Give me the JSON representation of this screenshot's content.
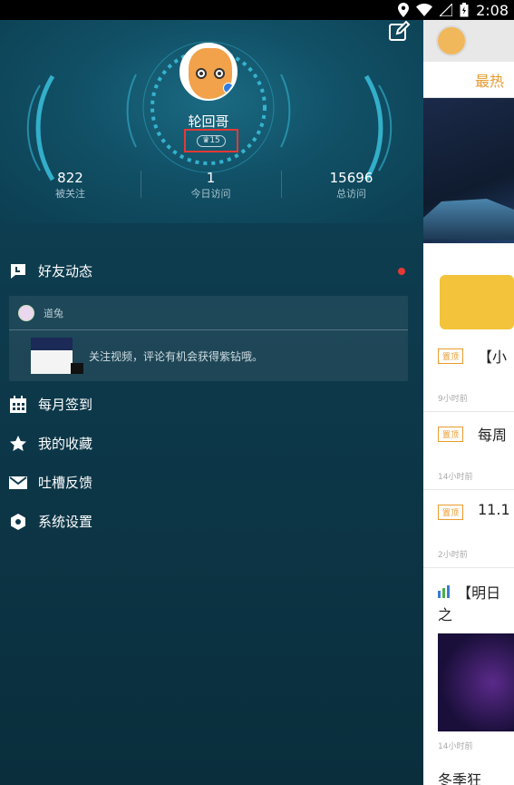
{
  "status_bar": {
    "time": "2:08"
  },
  "drawer": {
    "username": "轮回哥",
    "level": "15",
    "stats": [
      {
        "value": "822",
        "label": "被关注"
      },
      {
        "value": "1",
        "label": "今日访问"
      },
      {
        "value": "15696",
        "label": "总访问"
      }
    ],
    "menu": {
      "friend_feed": "好友动态",
      "monthly_checkin": "每月签到",
      "favorites": "我的收藏",
      "feedback": "吐槽反馈",
      "settings": "系统设置"
    },
    "friend_card": {
      "user": "道兔",
      "text": "关注视频，评论有机会获得紫钻哦。"
    }
  },
  "main": {
    "tab_hot": "最热",
    "feed": [
      {
        "tag": "置顶",
        "title": "【小",
        "time": "9小时前"
      },
      {
        "tag": "置顶",
        "title": "每周",
        "time": "14小时前"
      },
      {
        "tag": "置顶",
        "title": "11.1",
        "time": "2小时前"
      }
    ],
    "section_title": "【明日之",
    "section_time": "14小时前",
    "bottom_text": "冬季狂欢，"
  },
  "colors": {
    "accent": "#e89b2e",
    "highlight": "#e53935",
    "drawer_bg": "#0d3a4c"
  }
}
